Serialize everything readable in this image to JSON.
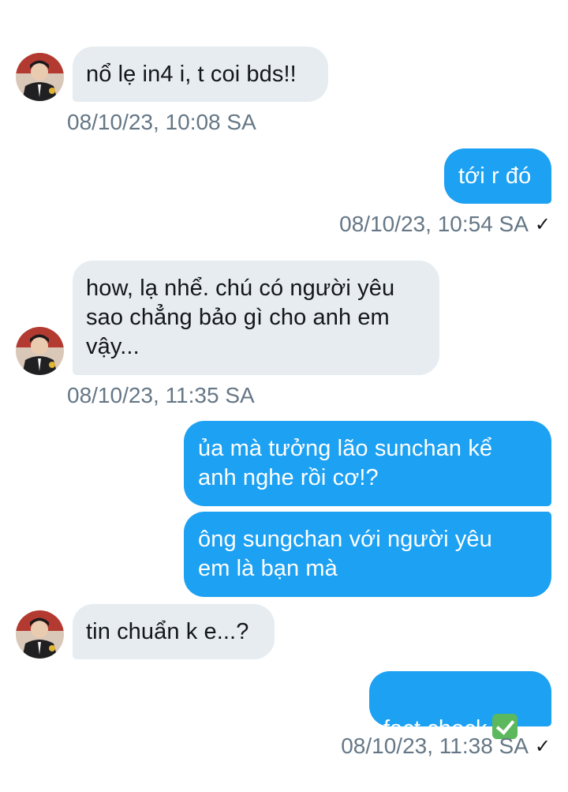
{
  "messages": [
    {
      "side": "in",
      "text": "nổ lẹ in4 i, t coi bds!!",
      "timestamp": "08/10/23, 10:08 SA"
    },
    {
      "side": "out",
      "text": "tới r đó",
      "timestamp": "08/10/23, 10:54 SA",
      "read_mark": "✓"
    },
    {
      "side": "in",
      "text": "how, lạ nhể. chú có người yêu\nsao chẳng bảo gì cho anh em\nvậy...",
      "timestamp": "08/10/23, 11:35 SA"
    },
    {
      "side": "out",
      "text": "ủa mà tưởng lão sunchan kể\nanh nghe rồi cơ!?"
    },
    {
      "side": "out",
      "text": "ông sungchan với người yêu\nem là bạn mà"
    },
    {
      "side": "in",
      "text": "tin chuẩn k e...?"
    },
    {
      "side": "out",
      "text": "fact check",
      "emoji": "white-check-mark-emoji",
      "timestamp": "08/10/23, 11:38 SA",
      "read_mark": "✓"
    }
  ],
  "colors": {
    "outgoing_bubble": "#1da1f2",
    "incoming_bubble": "#e6ecf0",
    "timestamp": "#657786"
  }
}
